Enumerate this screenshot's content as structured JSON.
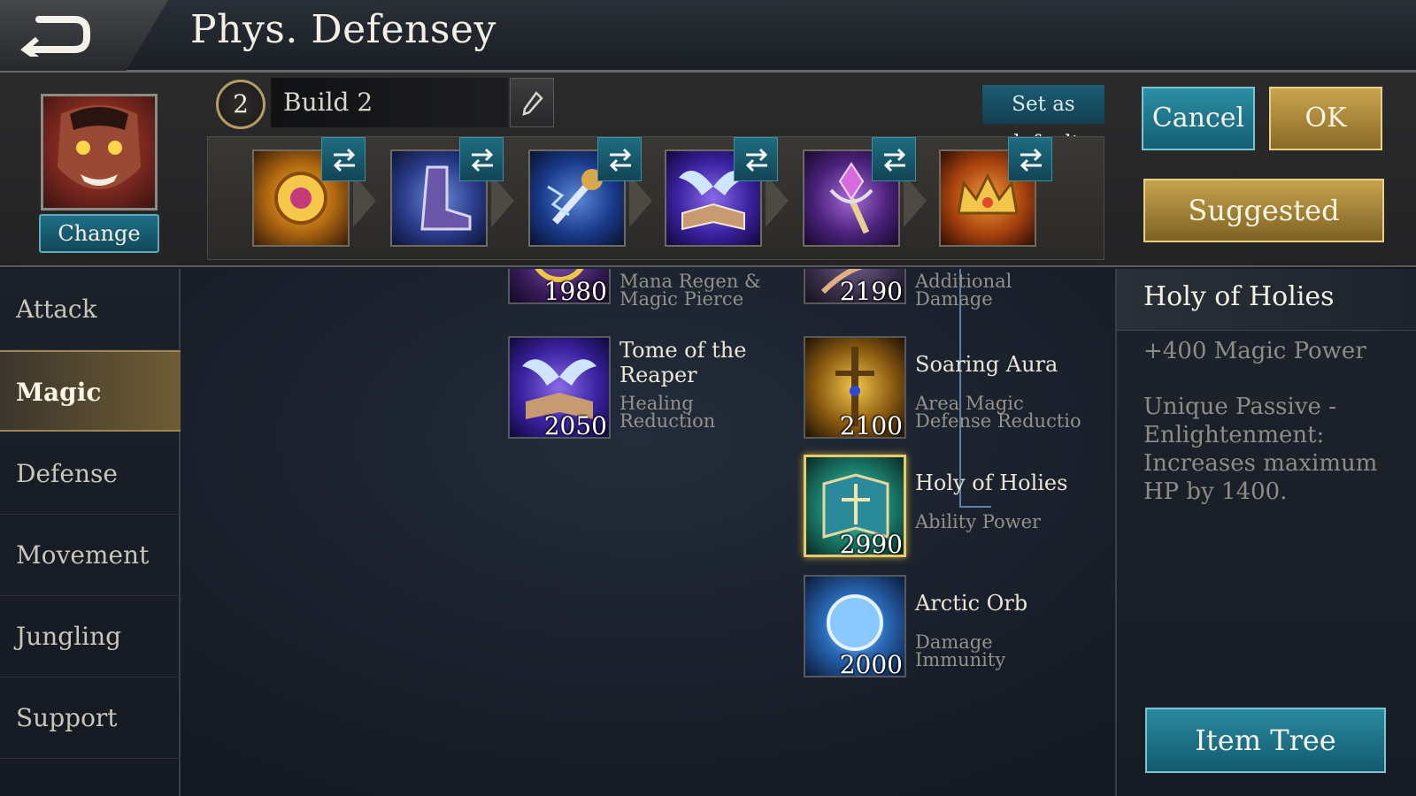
{
  "header": {
    "title": "Phys. Defensey",
    "back_icon": "back-arrow-icon"
  },
  "build": {
    "number": "2",
    "name": "Build 2",
    "set_default_label": "Set as default",
    "change_label": "Change",
    "cancel_label": "Cancel",
    "ok_label": "OK",
    "suggested_label": "Suggested"
  },
  "slots": [
    {
      "icon": "gold-amulet-icon",
      "color": "#c98a1d"
    },
    {
      "icon": "purple-boots-icon",
      "color": "#3a5fb8"
    },
    {
      "icon": "lightning-staff-icon",
      "color": "#2a4fa0"
    },
    {
      "icon": "winged-book-icon",
      "color": "#5a3cb0"
    },
    {
      "icon": "crystal-scepter-icon",
      "color": "#7a3cb0"
    },
    {
      "icon": "golden-crown-icon",
      "color": "#c9641d"
    }
  ],
  "categories": [
    "Attack",
    "Magic",
    "Defense",
    "Movement",
    "Jungling",
    "Support"
  ],
  "active_category": "Magic",
  "items": [
    {
      "name": "",
      "price": "1980",
      "desc_lines": [
        "Mana Regen &",
        "Magic Pierce"
      ],
      "icon": "gold-orb-icon",
      "color": "#5a3c8a"
    },
    {
      "name": "",
      "price": "2190",
      "desc_lines": [
        "Additional",
        "Damage"
      ],
      "icon": "feather-icon",
      "color": "#5a4a7a"
    },
    {
      "name_lines": [
        "Tome of the",
        "Reaper"
      ],
      "price": "2050",
      "desc_lines": [
        "Healing",
        "Reduction"
      ],
      "icon": "winged-book-icon",
      "color": "#4a3cb0"
    },
    {
      "name_lines": [
        "Soaring Aura"
      ],
      "price": "2100",
      "desc_lines": [
        "Area Magic",
        "Defense Reductio"
      ],
      "icon": "golden-sword-icon",
      "color": "#b88a1d"
    },
    {
      "name_lines": [
        "Holy of Holies"
      ],
      "price": "2990",
      "desc_lines": [
        "Ability Power"
      ],
      "icon": "holy-book-icon",
      "color": "#1d8a6a",
      "selected": true
    },
    {
      "name_lines": [
        "Arctic Orb"
      ],
      "price": "2000",
      "desc_lines": [
        "Damage",
        "Immunity"
      ],
      "icon": "ice-orb-icon",
      "color": "#2a6ab8"
    }
  ],
  "detail": {
    "title": "Holy of Holies",
    "stat": "+400 Magic Power",
    "passive_lines": [
      "Unique Passive -",
      "Enlightenment:",
      "Increases maximum",
      "HP by 1400."
    ],
    "item_tree_label": "Item Tree"
  }
}
